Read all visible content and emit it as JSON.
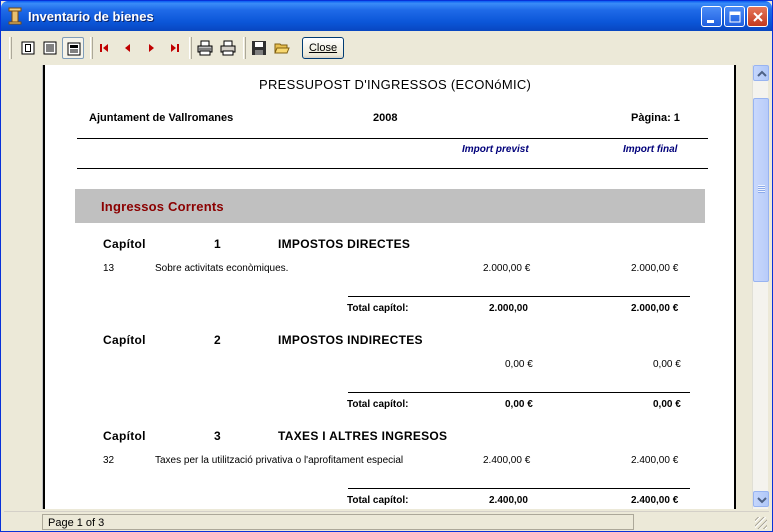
{
  "window": {
    "title": "Inventario de bienes"
  },
  "toolbar": {
    "close_label": "Close"
  },
  "report": {
    "title": "PRESSUPOST D'INGRESSOS (ECONóMIC)",
    "org": "Ajuntament de Vallromanes",
    "year": "2008",
    "page_label": "Pàgina: 1",
    "col_previst": "Import previst",
    "col_final": "Import final",
    "section": "Ingressos Corrents",
    "chapters": [
      {
        "label": "Capítol",
        "num": "1",
        "name": "IMPOSTOS DIRECTES",
        "line_code": "13",
        "line_desc": "Sobre activitats econòmiques.",
        "line_previst": "2.000,00 €",
        "line_final": "2.000,00 €",
        "total_label": "Total capítol:",
        "total_previst": "2.000,00",
        "total_final": "2.000,00 €"
      },
      {
        "label": "Capítol",
        "num": "2",
        "name": "IMPOSTOS INDIRECTES",
        "line_code": "",
        "line_desc": "",
        "line_previst": "0,00 €",
        "line_final": "0,00 €",
        "total_label": "Total capítol:",
        "total_previst": "0,00 €",
        "total_final": "0,00 €"
      },
      {
        "label": "Capítol",
        "num": "3",
        "name": "TAXES I ALTRES INGRESOS",
        "line_code": "32",
        "line_desc": "Taxes per la utilització privativa o l'aprofitament especial",
        "line_previst": "2.400,00 €",
        "line_final": "2.400,00 €",
        "total_label": "Total capítol:",
        "total_previst": "2.400,00",
        "total_final": "2.400,00 €"
      }
    ]
  },
  "status": {
    "page_info": "Page 1 of 3"
  }
}
